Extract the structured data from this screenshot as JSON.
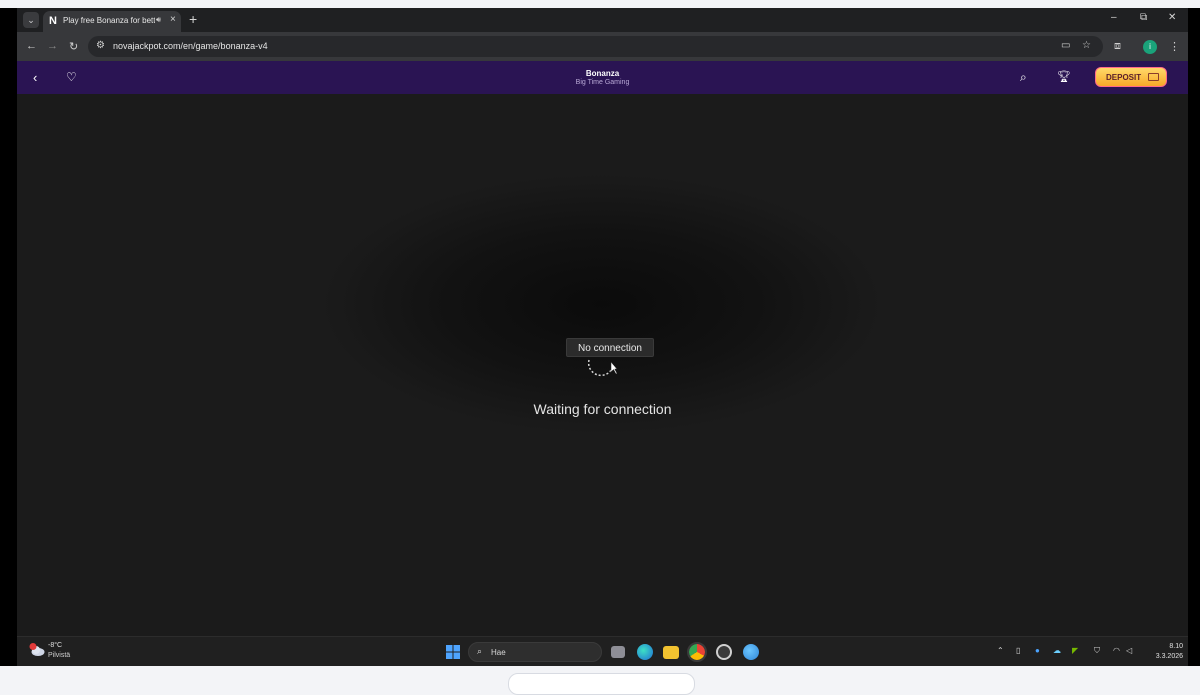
{
  "browser": {
    "tab": {
      "favicon": "N",
      "title": "Play free Bonanza for betting",
      "audio_icon": "speaker-icon",
      "close": "×"
    },
    "new_tab": "+",
    "window_controls": {
      "minimize": "–",
      "restore": "⧉",
      "close": "✕"
    },
    "url": "novajackpot.com/en/game/bonanza-v4",
    "profile_initial": "i"
  },
  "site": {
    "game_title": "Bonanza",
    "provider": "Big Time Gaming",
    "deposit_label": "DEPOSIT",
    "colors": {
      "header": "#2a1453",
      "deposit_top": "#ffd96a",
      "deposit_bottom": "#f7a928"
    }
  },
  "game": {
    "tooltip": "No connection",
    "status": "Waiting for connection"
  },
  "taskbar": {
    "weather": {
      "temp": "-8°C",
      "desc": "Pilvistä",
      "badge": "1"
    },
    "search_label": "Hae",
    "clock": {
      "time": "8.10",
      "date": "3.3.2026"
    }
  }
}
